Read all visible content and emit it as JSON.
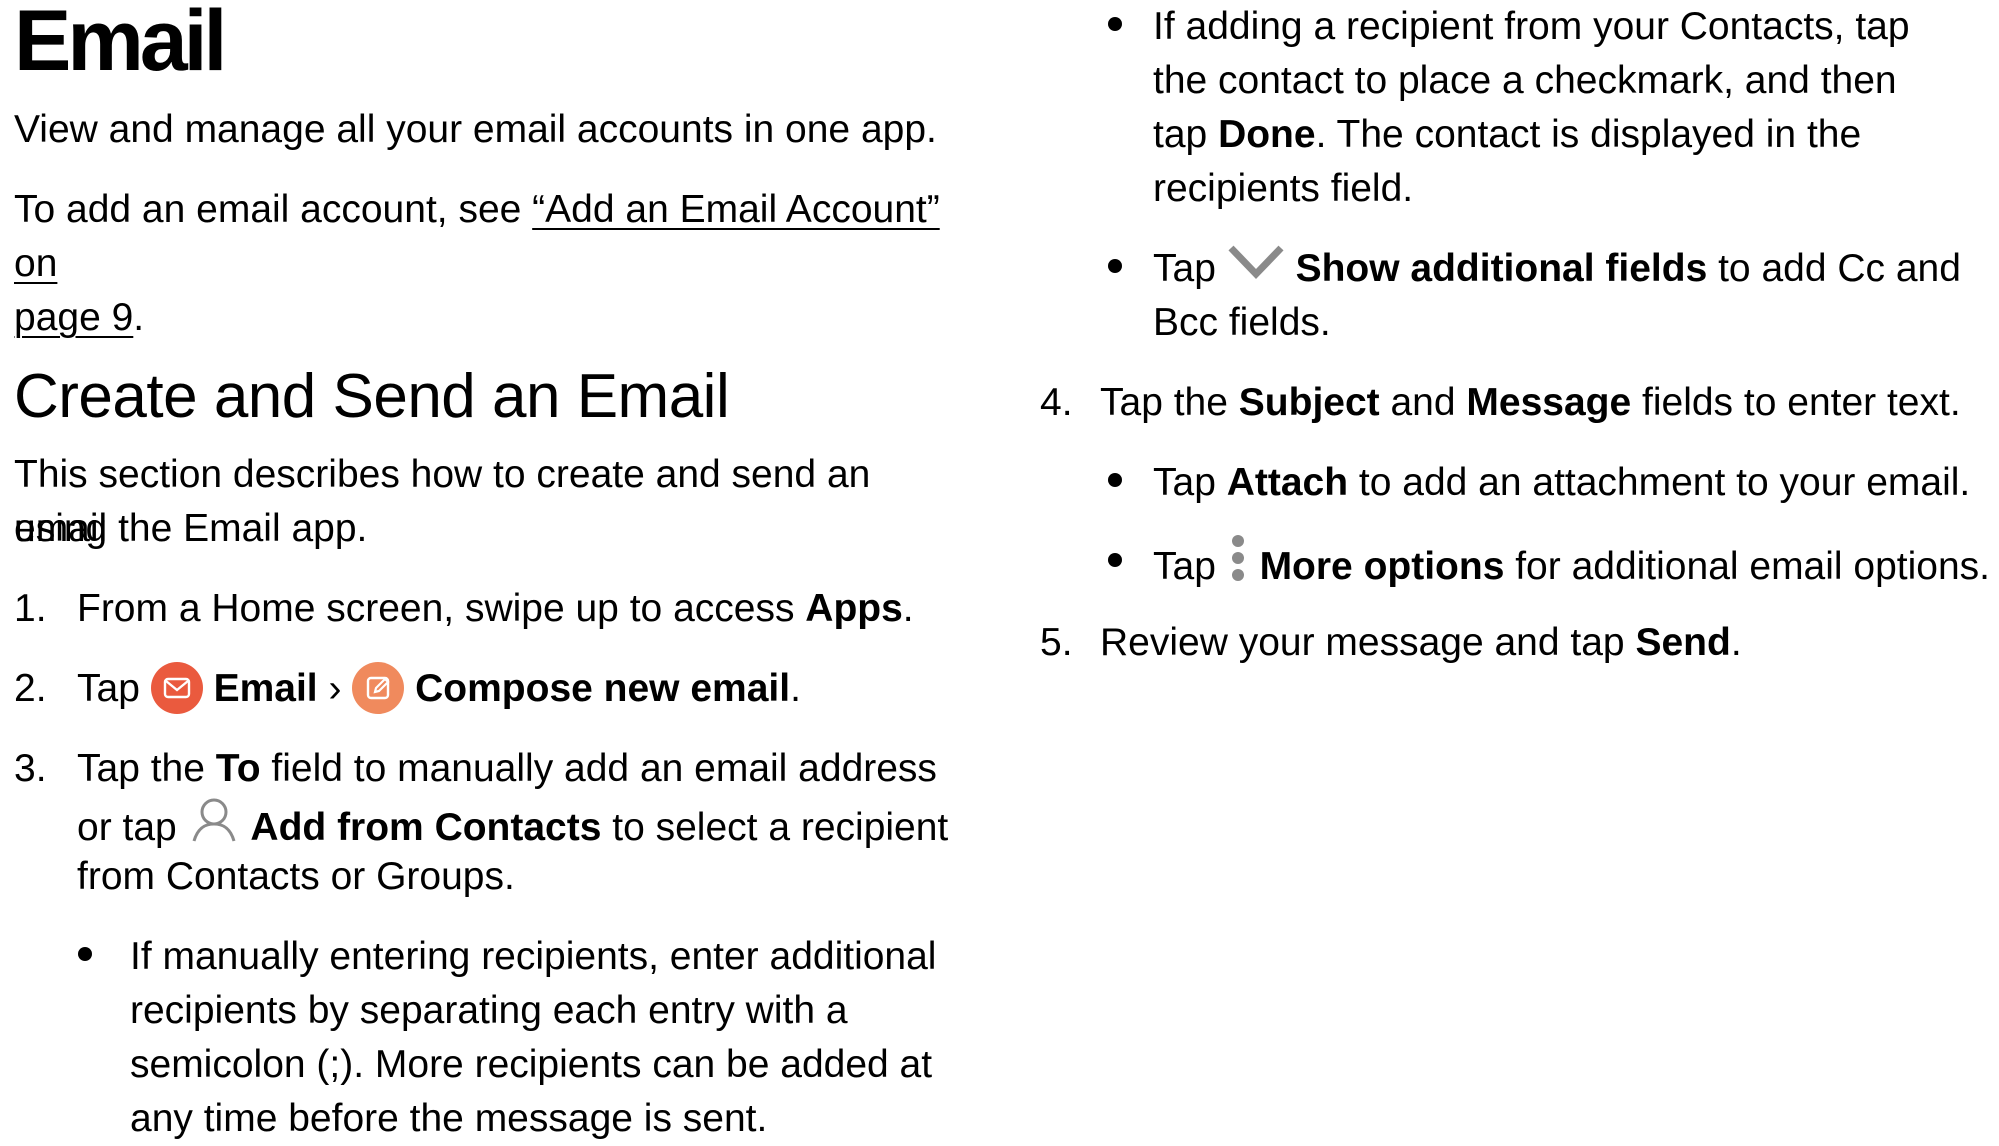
{
  "page": {
    "title": "Email",
    "intro": "View and manage all your email accounts in one app.",
    "add_account": {
      "prefix": "To add an email account, see ",
      "link_line1": "“Add an Email Account” on ",
      "link_line2": "page 9",
      "suffix": "."
    },
    "section_title": "Create and Send an Email",
    "section_intro_line1": "This section describes how to create and send an email",
    "section_intro_line2": "using the Email app."
  },
  "steps": {
    "s1": {
      "num": "1.",
      "text": "From a Home screen, swipe up to access ",
      "bold": "Apps",
      "end": "."
    },
    "s2": {
      "num": "2.",
      "tap": "Tap ",
      "email": "Email",
      "sep": " › ",
      "compose": "Compose new email",
      "end": "."
    },
    "s3": {
      "num": "3.",
      "l1_a": "Tap the ",
      "l1_b": "To",
      "l1_c": " field to manually add an email address",
      "l2_a": "or tap ",
      "l2_b": "Add from Contacts",
      "l2_c": " to select a recipient",
      "l3": "from Contacts or Groups.",
      "b1_l1": "If manually entering recipients, enter additional",
      "b1_l2": "recipients by separating each entry with a",
      "b1_l3": "semicolon (;). More recipients can be added at",
      "b1_l4": "any time before the message is sent.",
      "b2_l1": "If adding a recipient from your Contacts, tap",
      "b2_l2": "the contact to place a checkmark, and then",
      "b2_l3a": "tap ",
      "b2_l3b": "Done",
      "b2_l3c": ". The contact is displayed in the",
      "b2_l4": "recipients field.",
      "b3_l1a": "Tap ",
      "b3_l1b": "Show additional fields",
      "b3_l1c": " to add Cc and",
      "b3_l2": "Bcc fields."
    },
    "s4": {
      "num": "4.",
      "a": "Tap the ",
      "b": "Subject",
      "c": " and ",
      "d": "Message",
      "e": " fields to enter text.",
      "b1_a": "Tap ",
      "b1_b": "Attach",
      "b1_c": " to add an attachment to your email.",
      "b2_a": "Tap ",
      "b2_b": "More options",
      "b2_c": " for additional email options."
    },
    "s5": {
      "num": "5.",
      "a": "Review your message and tap ",
      "b": "Send",
      "c": "."
    }
  },
  "icons": {
    "email_app": "email-app-icon",
    "compose": "compose-icon",
    "contacts": "contacts-person-icon",
    "chevron": "chevron-down-icon",
    "more_options": "more-options-icon"
  },
  "colors": {
    "email_icon_bg": "#ea5a3e",
    "compose_icon_bg": "#f08a5d",
    "icon_gray": "#8a8a8a"
  }
}
